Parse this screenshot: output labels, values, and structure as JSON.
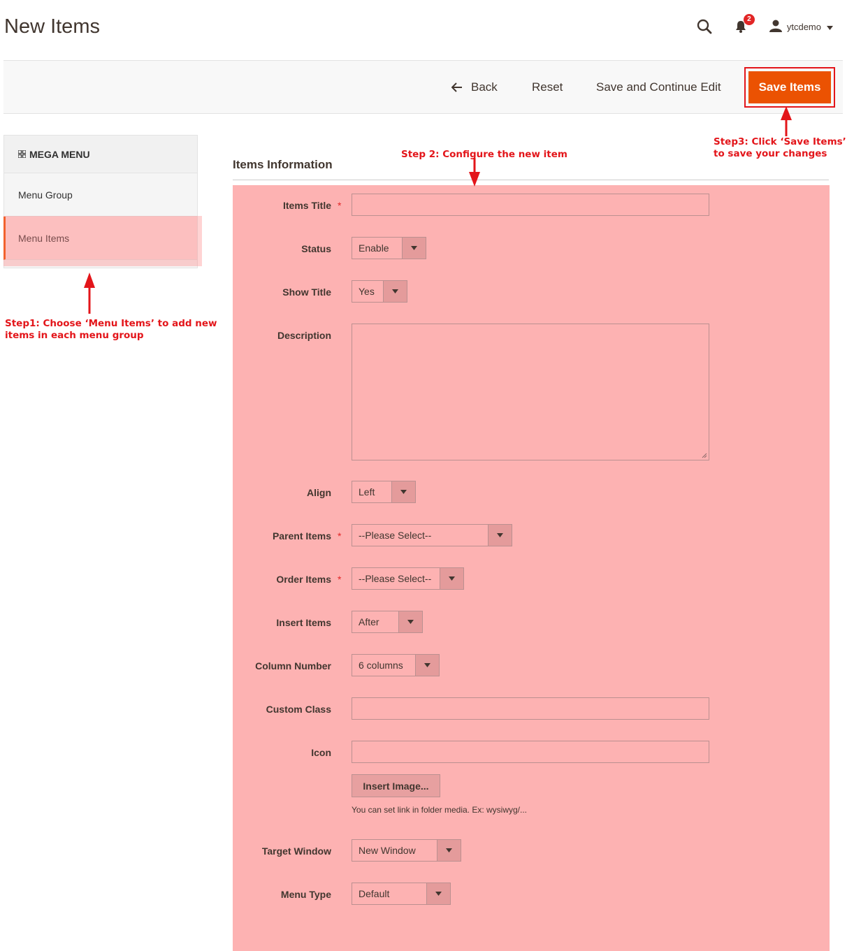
{
  "header": {
    "title": "New Items",
    "notifications_count": "2",
    "username": "ytcdemo"
  },
  "toolbar": {
    "back": "Back",
    "reset": "Reset",
    "save_continue": "Save and Continue Edit",
    "save": "Save Items"
  },
  "sidebar": {
    "title": "MEGA MENU",
    "items": [
      {
        "label": "Menu Group"
      },
      {
        "label": "Menu Items"
      }
    ]
  },
  "annotations": {
    "step1": [
      "Step1: Choose ‘Menu Items’ to add new",
      "items in each menu group"
    ],
    "step2": "Step 2: Configure the new item",
    "step3": [
      "Step3: Click ‘Save Items’",
      "to save your changes"
    ]
  },
  "form": {
    "section_title": "Items Information",
    "items_title": {
      "label": "Items Title",
      "value": ""
    },
    "status": {
      "label": "Status",
      "value": "Enable"
    },
    "show_title": {
      "label": "Show Title",
      "value": "Yes"
    },
    "description": {
      "label": "Description",
      "value": ""
    },
    "align": {
      "label": "Align",
      "value": "Left"
    },
    "parent_items": {
      "label": "Parent Items",
      "value": "--Please Select--"
    },
    "order_items": {
      "label": "Order Items",
      "value": "--Please Select--"
    },
    "insert_items": {
      "label": "Insert Items",
      "value": "After"
    },
    "column_number": {
      "label": "Column Number",
      "value": "6 columns"
    },
    "custom_class": {
      "label": "Custom Class",
      "value": ""
    },
    "icon": {
      "label": "Icon",
      "value": "",
      "button": "Insert Image...",
      "note": "You can set link in folder media. Ex: wysiwyg/..."
    },
    "target_window": {
      "label": "Target Window",
      "value": "New Window"
    },
    "menu_type": {
      "label": "Menu Type",
      "value": "Default"
    }
  },
  "colors": {
    "accent": "#eb5202",
    "annotation_red": "#e3151a",
    "highlight_pink": "#fdb2b2"
  }
}
